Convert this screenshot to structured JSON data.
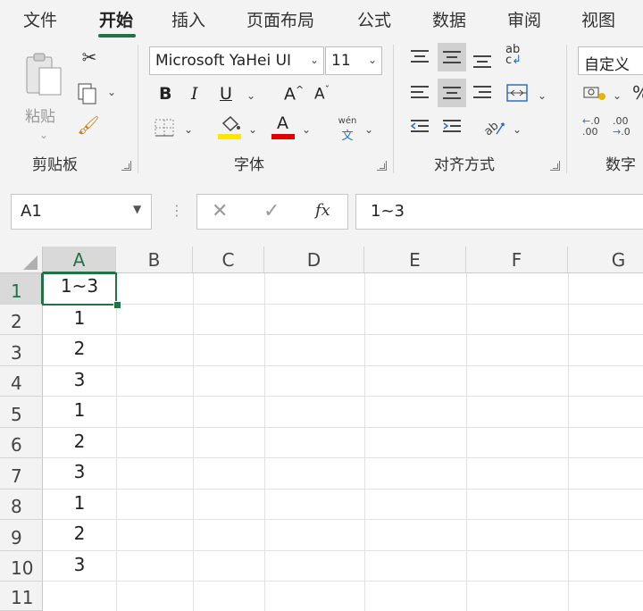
{
  "tabs": [
    {
      "label": "文件",
      "active": false
    },
    {
      "label": "开始",
      "active": true
    },
    {
      "label": "插入",
      "active": false
    },
    {
      "label": "页面布局",
      "active": false
    },
    {
      "label": "公式",
      "active": false
    },
    {
      "label": "数据",
      "active": false
    },
    {
      "label": "审阅",
      "active": false
    },
    {
      "label": "视图",
      "active": false
    }
  ],
  "ribbon": {
    "clipboard": {
      "paste_label": "粘贴",
      "group_label": "剪贴板"
    },
    "font": {
      "font_name": "Microsoft YaHei UI",
      "font_size": "11",
      "group_label": "字体",
      "phonetic_top": "wén",
      "phonetic_bottom": "文",
      "grow_label": "A",
      "shrink_label": "A",
      "bold": "B",
      "italic": "I",
      "underline": "U",
      "font_color_label": "A"
    },
    "alignment": {
      "group_label": "对齐方式"
    },
    "number": {
      "format": "自定义",
      "group_label": "数字"
    }
  },
  "formula_bar": {
    "name_box": "A1",
    "formula": "1~3",
    "fx_label": "fx"
  },
  "colors": {
    "accent": "#217346",
    "fill_yellow": "#ffe600",
    "font_red": "#e00000"
  },
  "columns": [
    "A",
    "B",
    "C",
    "D",
    "E",
    "F",
    "G"
  ],
  "rows": [
    "1",
    "2",
    "3",
    "4",
    "5",
    "6",
    "7",
    "8",
    "9",
    "10",
    "11"
  ],
  "cells_col_a": [
    "1~3",
    "1",
    "2",
    "3",
    "1",
    "2",
    "3",
    "1",
    "2",
    "3",
    ""
  ],
  "selected_cell": "A1"
}
